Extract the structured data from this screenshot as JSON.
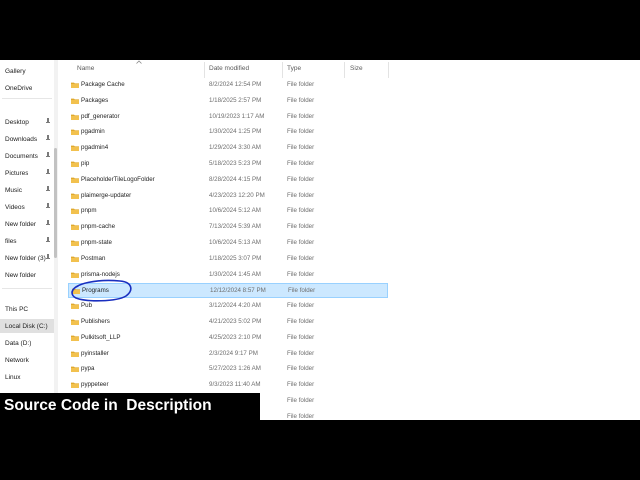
{
  "sidebar": {
    "items": [
      {
        "label": "Gallery",
        "icon": "gallery-icon",
        "pinned": false,
        "color": "#3b78d8"
      },
      {
        "label": "OneDrive",
        "icon": "onedrive-icon",
        "pinned": false,
        "color": "#1f6fd1"
      },
      {
        "label": "Desktop",
        "icon": "desktop-icon",
        "pinned": true,
        "color": "#2d8fe0"
      },
      {
        "label": "Downloads",
        "icon": "downloads-icon",
        "pinned": true,
        "color": "#2a9d5c"
      },
      {
        "label": "Documents",
        "icon": "documents-icon",
        "pinned": true,
        "color": "#6b7c93"
      },
      {
        "label": "Pictures",
        "icon": "pictures-icon",
        "pinned": true,
        "color": "#2e86de"
      },
      {
        "label": "Music",
        "icon": "music-icon",
        "pinned": true,
        "color": "#e0467c"
      },
      {
        "label": "Videos",
        "icon": "videos-icon",
        "pinned": true,
        "color": "#8c4fd6"
      },
      {
        "label": "New folder",
        "icon": "folder-icon",
        "pinned": true,
        "color": "#f2c14e"
      },
      {
        "label": "files",
        "icon": "folder-icon",
        "pinned": true,
        "color": "#f2c14e"
      },
      {
        "label": "New folder (3)",
        "icon": "folder-icon",
        "pinned": true,
        "color": "#f2c14e"
      },
      {
        "label": "New folder",
        "icon": "folder-icon",
        "pinned": false,
        "color": "#f2c14e"
      },
      {
        "label": "This PC",
        "icon": "this-pc-icon",
        "pinned": false,
        "color": "#3a7bd5"
      },
      {
        "label": "Local Disk (C:)",
        "icon": "drive-icon",
        "pinned": false,
        "color": "#6d6d6d"
      },
      {
        "label": "Data (D:)",
        "icon": "drive-icon",
        "pinned": false,
        "color": "#6d6d6d"
      },
      {
        "label": "Network",
        "icon": "network-icon",
        "pinned": false,
        "color": "#3a7bd5"
      },
      {
        "label": "Linux",
        "icon": "linux-icon",
        "pinned": false,
        "color": "#333333"
      }
    ]
  },
  "columns": {
    "name": "Name",
    "date": "Date modified",
    "type": "Type",
    "size": "Size"
  },
  "files": [
    {
      "name": "Package Cache",
      "date": "8/2/2024 12:54 PM",
      "type": "File folder"
    },
    {
      "name": "Packages",
      "date": "1/18/2025 2:57 PM",
      "type": "File folder"
    },
    {
      "name": "pdf_generator",
      "date": "10/19/2023 1:17 AM",
      "type": "File folder"
    },
    {
      "name": "pgadmin",
      "date": "1/30/2024 1:25 PM",
      "type": "File folder"
    },
    {
      "name": "pgadmin4",
      "date": "1/29/2024 3:30 AM",
      "type": "File folder"
    },
    {
      "name": "pip",
      "date": "5/18/2023 5:23 PM",
      "type": "File folder"
    },
    {
      "name": "PlaceholderTileLogoFolder",
      "date": "8/28/2024 4:15 PM",
      "type": "File folder"
    },
    {
      "name": "plaimerge-updater",
      "date": "4/23/2023 12:20 PM",
      "type": "File folder"
    },
    {
      "name": "pnpm",
      "date": "10/6/2024 5:12 AM",
      "type": "File folder"
    },
    {
      "name": "pnpm-cache",
      "date": "7/13/2024 5:39 AM",
      "type": "File folder"
    },
    {
      "name": "pnpm-state",
      "date": "10/6/2024 5:13 AM",
      "type": "File folder"
    },
    {
      "name": "Postman",
      "date": "1/18/2025 3:07 PM",
      "type": "File folder"
    },
    {
      "name": "prisma-nodejs",
      "date": "1/30/2024 1:45 AM",
      "type": "File folder"
    },
    {
      "name": "Programs",
      "date": "12/12/2024 8:57 PM",
      "type": "File folder",
      "selected": true
    },
    {
      "name": "Pub",
      "date": "3/12/2024 4:20 AM",
      "type": "File folder"
    },
    {
      "name": "Publishers",
      "date": "4/21/2023 5:02 PM",
      "type": "File folder"
    },
    {
      "name": "Pulkitsoft_LLP",
      "date": "4/25/2023 2:10 PM",
      "type": "File folder"
    },
    {
      "name": "pyinstaller",
      "date": "2/3/2024 9:17 PM",
      "type": "File folder"
    },
    {
      "name": "pypa",
      "date": "5/27/2023 1:26 AM",
      "type": "File folder"
    },
    {
      "name": "pyppeteer",
      "date": "9/3/2023 11:40 AM",
      "type": "File folder"
    },
    {
      "name": "",
      "date": "",
      "type": "File folder"
    },
    {
      "name": "",
      "date": "",
      "type": "File folder"
    }
  ],
  "banner": {
    "text": "Source Code in  Description"
  },
  "colors": {
    "folder": "#f2c14e",
    "folder_dark": "#e0a92c",
    "selection_bg": "#cce8ff",
    "selection_border": "#99d1ff",
    "annotation": "#1a2fbf"
  }
}
